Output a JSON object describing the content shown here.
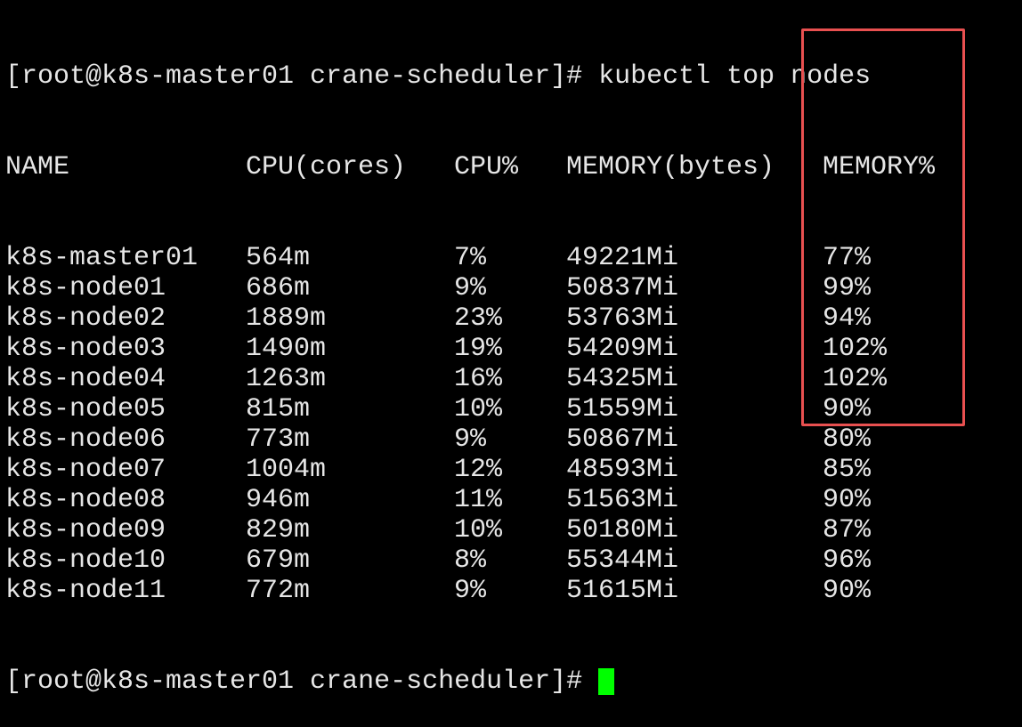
{
  "prompt": "[root@k8s-master01 crane-scheduler]# ",
  "command": "kubectl top nodes",
  "headers": [
    "NAME",
    "CPU(cores)",
    "CPU%",
    "MEMORY(bytes)",
    "MEMORY%"
  ],
  "rows": [
    [
      "k8s-master01",
      "564m",
      "7%",
      "49221Mi",
      "77%"
    ],
    [
      "k8s-node01",
      "686m",
      "9%",
      "50837Mi",
      "99%"
    ],
    [
      "k8s-node02",
      "1889m",
      "23%",
      "53763Mi",
      "94%"
    ],
    [
      "k8s-node03",
      "1490m",
      "19%",
      "54209Mi",
      "102%"
    ],
    [
      "k8s-node04",
      "1263m",
      "16%",
      "54325Mi",
      "102%"
    ],
    [
      "k8s-node05",
      "815m",
      "10%",
      "51559Mi",
      "90%"
    ],
    [
      "k8s-node06",
      "773m",
      "9%",
      "50867Mi",
      "80%"
    ],
    [
      "k8s-node07",
      "1004m",
      "12%",
      "48593Mi",
      "85%"
    ],
    [
      "k8s-node08",
      "946m",
      "11%",
      "51563Mi",
      "90%"
    ],
    [
      "k8s-node09",
      "829m",
      "10%",
      "50180Mi",
      "87%"
    ],
    [
      "k8s-node10",
      "679m",
      "8%",
      "55344Mi",
      "96%"
    ],
    [
      "k8s-node11",
      "772m",
      "9%",
      "51615Mi",
      "90%"
    ]
  ],
  "colors": {
    "text": "#e6e6e6",
    "highlight": "#e85050",
    "cursor": "#00ff00",
    "background": "#000000"
  }
}
